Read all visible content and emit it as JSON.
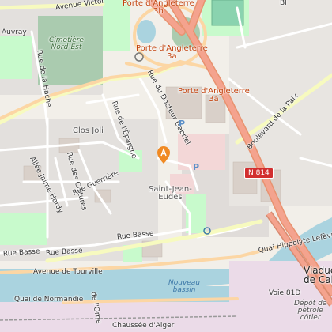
{
  "map": {
    "labels": {
      "porte_3b": "Porte d'Angleterre\n3b",
      "porte_3a_top": "Porte d'Angleterre\n3a",
      "porte_3a_right": "Porte d'Angleterre\n3a",
      "cimetiere": "Cimetière\nNord-Est",
      "clos_joli": "Clos Joli",
      "saint_jean": "Saint-Jean-\nEudes",
      "rue_hache": "Rue de la Hache",
      "rue_docteur": "Rue du Docteur Gabriel",
      "rue_epargne": "Rue de l'Épargne",
      "rue_guerriere": "Rue Guerrière",
      "rue_cultures": "Rue des Cultures",
      "allee_hardy": "Allée Jaime Hardy",
      "rue_basse_1": "Rue Basse",
      "rue_basse_2": "Rue Basse",
      "avenue_victor": "Avenue Victor",
      "auvray": "Auvray",
      "avenue_tourville": "Avenue de Tourville",
      "boulevard_paix": "Boulevard de la Paix",
      "quai_lefevre": "Quai Hippolyte Lefèvre",
      "quai_normandie": "Quai de Normandie",
      "chaussee_alger": "Chaussée d'Alger",
      "nouveau_bassin": "Nouveau\nbassin",
      "viaduc": "Viaduc\nde Cal",
      "depot": "Dépôt de\npétrole\ncôtier",
      "voie": "Voie 81D",
      "orne": "de l'Orne",
      "bl": "Bl"
    },
    "shield": "N 814",
    "parking": "P",
    "colors": {
      "land": "#f2efe9",
      "residential": "#e0dfdf",
      "green": "#c8facc",
      "cemetery": "#aacbaf",
      "water": "#aad3df",
      "trunk": "#f4a38e",
      "primary": "#fcd6a4",
      "marker": "#f08a24"
    }
  }
}
